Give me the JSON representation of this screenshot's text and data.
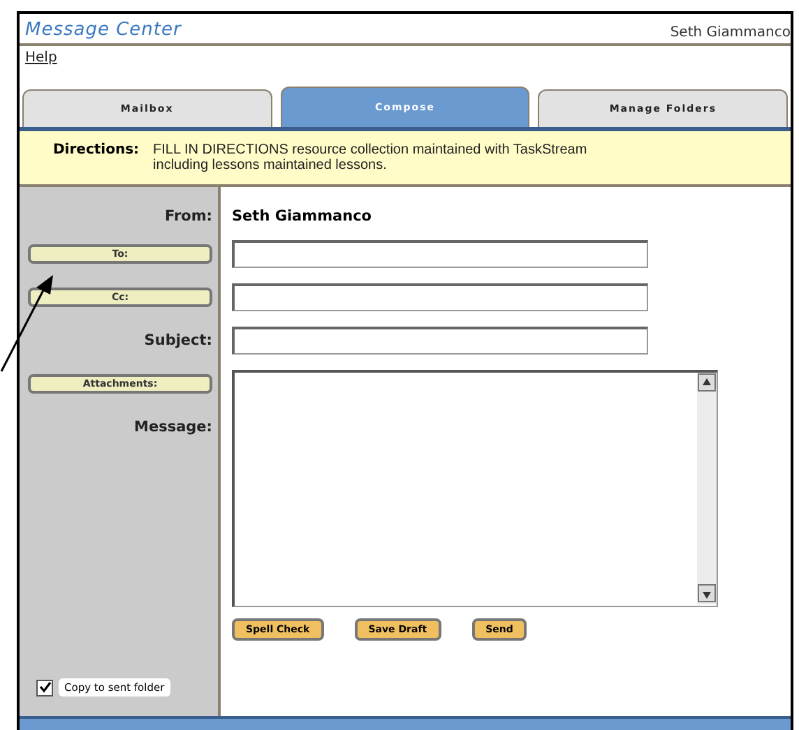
{
  "header": {
    "title": "Message Center",
    "user": "Seth Giammanco"
  },
  "help_link": "Help",
  "tabs": [
    {
      "label": "Mailbox",
      "selected": false
    },
    {
      "label": "Compose",
      "selected": true
    },
    {
      "label": "Manage Folders",
      "selected": false
    }
  ],
  "directions": {
    "label": "Directions:",
    "text": "FILL IN DIRECTIONS resource collection maintained with TaskStream including lessons maintained lessons."
  },
  "form": {
    "from_label": "From:",
    "from_value": "Seth Giammanco",
    "rows": [
      {
        "kind": "button",
        "label": "To:"
      },
      {
        "kind": "button",
        "label": "Cc:"
      },
      {
        "kind": "label",
        "label": "Subject:"
      }
    ],
    "attachments_button": "Attachments:",
    "message_label": "Message:"
  },
  "copy_to_sent": {
    "label": "Copy to sent folder",
    "checked": true
  },
  "actions": [
    "Spell Check",
    "Save Draft",
    "Send"
  ]
}
